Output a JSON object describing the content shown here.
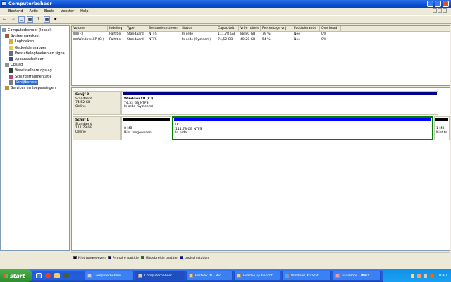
{
  "window": {
    "title": "Computerbeheer"
  },
  "menu": [
    "Bestand",
    "Actie",
    "Beeld",
    "Venster",
    "Help"
  ],
  "tree": [
    {
      "label": "Computerbeheer (lokaal)",
      "level": 0
    },
    {
      "label": "Systeemwerkset",
      "level": 1
    },
    {
      "label": "Logboeken",
      "level": 2
    },
    {
      "label": "Gedeelde mappen",
      "level": 2
    },
    {
      "label": "Prestatielogboeken en signa",
      "level": 2
    },
    {
      "label": "Apparaatbeheer",
      "level": 2
    },
    {
      "label": "Opslag",
      "level": 1
    },
    {
      "label": "Verwisselbare opslag",
      "level": 2
    },
    {
      "label": "Schijfdefragmentatie",
      "level": 2
    },
    {
      "label": "Schijfbeheer",
      "level": 2,
      "selected": true
    },
    {
      "label": "Services en toepassingen",
      "level": 1
    }
  ],
  "volumes": {
    "columns": [
      "Volume",
      "Indeling",
      "Type",
      "Bestandssysteem",
      "Status",
      "Capaciteit",
      "Vrije ruimte",
      "Percentage vrij",
      "Fouttolerantie",
      "Overhead"
    ],
    "rows": [
      [
        "(F:)",
        "Partitie",
        "Standaard",
        "NTFS",
        "In orde",
        "111,78 GB",
        "88,80 GB",
        "79 %",
        "Nee",
        "0%"
      ],
      [
        "WindowsXP (C:)",
        "Partitie",
        "Standaard",
        "NTFS",
        "In orde (Systeem)",
        "74,52 GB",
        "40,20 GB",
        "54 %",
        "Nee",
        "0%"
      ]
    ]
  },
  "disks": [
    {
      "name": "Schijf 0",
      "type": "Standaard",
      "size": "74,52 GB",
      "state": "Online",
      "partitions": [
        {
          "name": "WindowsXP  (C:)",
          "size": "74,52 GB NTFS",
          "status": "In orde (Systeem)"
        }
      ]
    },
    {
      "name": "Schijf 1",
      "type": "Standaard",
      "size": "111,79 GB",
      "state": "Online",
      "unalloc1": {
        "size": "8 MB",
        "status": "Niet toegewezen"
      },
      "logical": {
        "name": "(F:)",
        "size": "111,78 GB NTFS",
        "status": "In orde"
      },
      "unalloc2": {
        "size": "1 MB",
        "status": "Niet to"
      }
    }
  ],
  "legend": [
    {
      "label": "Niet toegewezen",
      "color": "#000000"
    },
    {
      "label": "Primaire partitie",
      "color": "#00008b"
    },
    {
      "label": "Uitgebreide partitie",
      "color": "#008000"
    },
    {
      "label": "Logisch station",
      "color": "#0000ff"
    }
  ],
  "taskbar": {
    "start": "start",
    "tasks": [
      "Computerbeheer",
      "Computerbeheer",
      "Postvak IN - Mic...",
      "Reactie op bericht...",
      "Windows Xp Stat...",
      "naamloos - Paint"
    ],
    "lang": "NL",
    "clock": "10:40"
  }
}
